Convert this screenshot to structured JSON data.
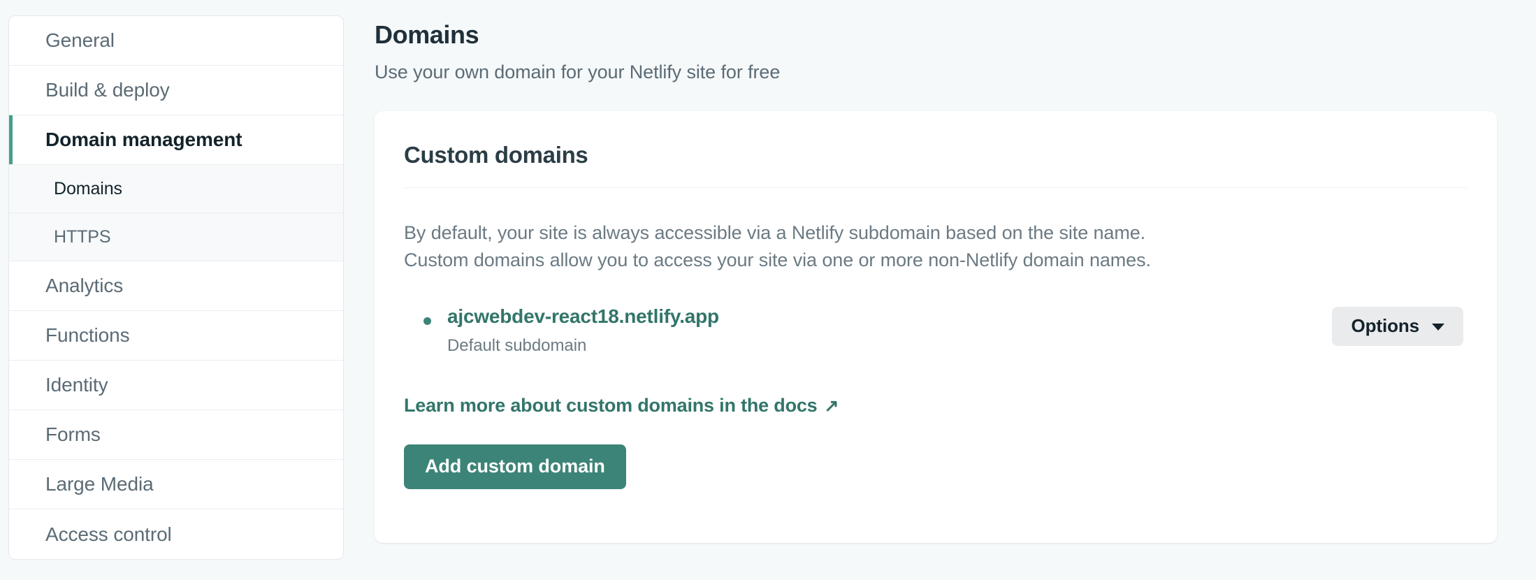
{
  "sidebar": {
    "items": [
      {
        "label": "General",
        "state": "default",
        "level": "top"
      },
      {
        "label": "Build & deploy",
        "state": "default",
        "level": "top"
      },
      {
        "label": "Domain management",
        "state": "active",
        "level": "top"
      },
      {
        "label": "Domains",
        "state": "sub-active",
        "level": "sub"
      },
      {
        "label": "HTTPS",
        "state": "default",
        "level": "sub"
      },
      {
        "label": "Analytics",
        "state": "default",
        "level": "top"
      },
      {
        "label": "Functions",
        "state": "default",
        "level": "top"
      },
      {
        "label": "Identity",
        "state": "default",
        "level": "top"
      },
      {
        "label": "Forms",
        "state": "default",
        "level": "top"
      },
      {
        "label": "Large Media",
        "state": "default",
        "level": "top"
      },
      {
        "label": "Access control",
        "state": "default",
        "level": "top"
      }
    ]
  },
  "header": {
    "title": "Domains",
    "subtitle": "Use your own domain for your Netlify site for free"
  },
  "card": {
    "title": "Custom domains",
    "body_line_1": "By default, your site is always accessible via a Netlify subdomain based on the site name.",
    "body_line_2": "Custom domains allow you to access your site via one or more non-Netlify domain names.",
    "domain": {
      "name": "ajcwebdev-react18.netlify.app",
      "subtitle": "Default subdomain",
      "options_label": "Options",
      "chevron_icon": "chevron-down-icon",
      "bullet_icon": "bullet-dot-icon"
    },
    "learn_more": {
      "label": "Learn more about custom domains in the docs",
      "external_icon": "external-link-arrow-icon"
    },
    "add_domain_label": "Add custom domain"
  },
  "colors": {
    "accent_teal": "#3d8478",
    "link_teal": "#32756a",
    "active_border": "#449e8e",
    "page_bg": "#f6f9fa",
    "options_bg": "#e9ebed"
  }
}
